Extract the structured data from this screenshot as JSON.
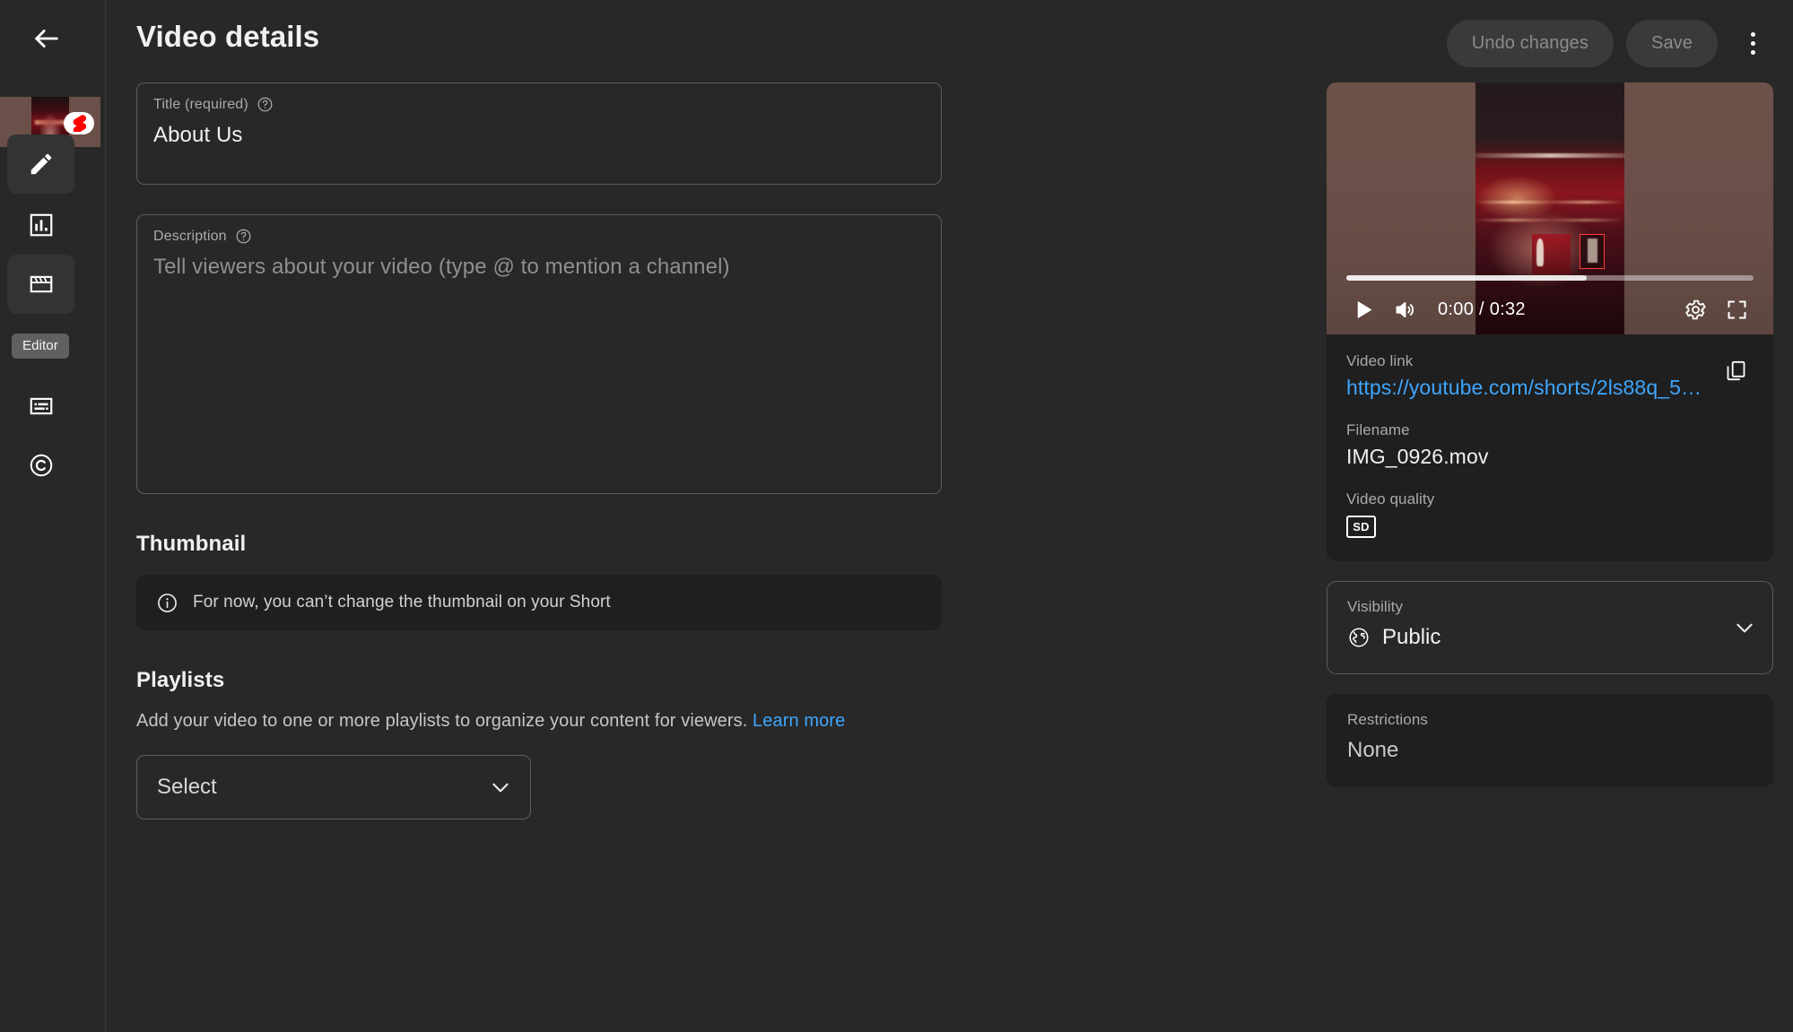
{
  "header": {
    "title": "Video details",
    "undo_label": "Undo changes",
    "save_label": "Save"
  },
  "sidebar": {
    "items": [
      {
        "name": "details",
        "icon": "pencil-icon",
        "active": true
      },
      {
        "name": "analytics",
        "icon": "analytics-icon",
        "active": false
      },
      {
        "name": "editor",
        "icon": "clapperboard-icon",
        "active": true
      },
      {
        "name": "subtitles",
        "icon": "subtitles-icon",
        "active": false
      },
      {
        "name": "copyright",
        "icon": "copyright-icon",
        "active": false
      }
    ],
    "tooltip": "Editor"
  },
  "form": {
    "title": {
      "label": "Title (required)",
      "value": "About Us"
    },
    "description": {
      "label": "Description",
      "placeholder": "Tell viewers about your video (type @ to mention a channel)",
      "value": ""
    },
    "thumbnail": {
      "heading": "Thumbnail",
      "notice": "For now, you can’t change the thumbnail on your Short"
    },
    "playlists": {
      "heading": "Playlists",
      "description": "Add your video to one or more playlists to organize your content for viewers.",
      "learn_more": "Learn more",
      "select_placeholder": "Select"
    }
  },
  "preview": {
    "player": {
      "current_time": "0:00",
      "duration": "0:32",
      "time_display": "0:00 / 0:32",
      "progress_percent": 59
    },
    "video_link": {
      "label": "Video link",
      "value": "https://youtube.com/shorts/2ls88q_5P…"
    },
    "filename": {
      "label": "Filename",
      "value": "IMG_0926.mov"
    },
    "video_quality": {
      "label": "Video quality",
      "value": "SD"
    }
  },
  "visibility": {
    "label": "Visibility",
    "value": "Public"
  },
  "restrictions": {
    "label": "Restrictions",
    "value": "None"
  },
  "colors": {
    "background": "#282828",
    "card": "#1f1f1f",
    "accent_link": "#3ea6ff",
    "border": "#5c5c5c",
    "text_primary": "#f1f1f1",
    "text_secondary": "#aaaaaa",
    "shorts_red": "#ff0000"
  }
}
